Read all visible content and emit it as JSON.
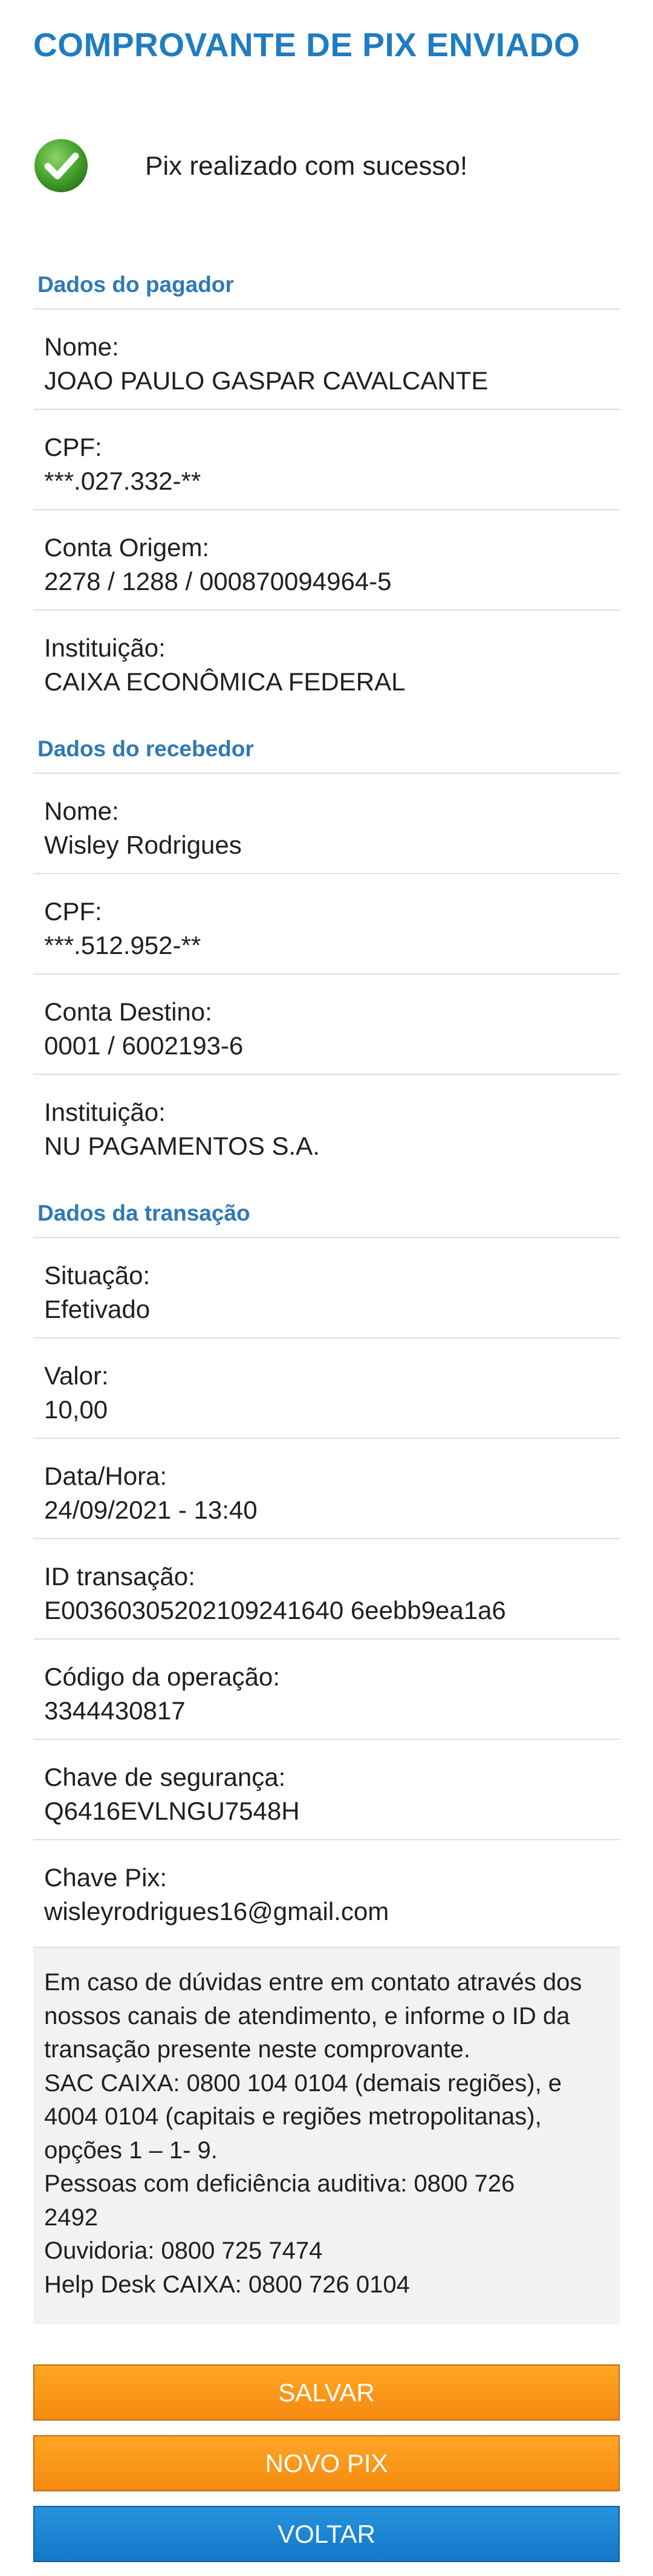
{
  "header": {
    "title": "COMPROVANTE DE PIX ENVIADO"
  },
  "status": {
    "icon": "check-circle-icon",
    "message": "Pix realizado com sucesso!",
    "color": "#3aa53a"
  },
  "pagador": {
    "section_title": "Dados do pagador",
    "fields": [
      {
        "label": "Nome:",
        "value": "JOAO PAULO GASPAR CAVALCANTE"
      },
      {
        "label": "CPF:",
        "value": "***.027.332-**"
      },
      {
        "label": "Conta Origem:",
        "value": "2278 / 1288 / 000870094964-5"
      },
      {
        "label": "Instituição:",
        "value": "CAIXA ECONÔMICA FEDERAL"
      }
    ]
  },
  "recebedor": {
    "section_title": "Dados do recebedor",
    "fields": [
      {
        "label": "Nome:",
        "value": "Wisley Rodrigues"
      },
      {
        "label": "CPF:",
        "value": "***.512.952-**"
      },
      {
        "label": "Conta Destino:",
        "value": "0001 / 6002193-6"
      },
      {
        "label": "Instituição:",
        "value": "NU PAGAMENTOS S.A."
      }
    ]
  },
  "transacao": {
    "section_title": "Dados da transação",
    "fields": [
      {
        "label": "Situação:",
        "value": "Efetivado"
      },
      {
        "label": "Valor:",
        "value": "10,00"
      },
      {
        "label": "Data/Hora:",
        "value": "24/09/2021 - 13:40"
      },
      {
        "label": "ID transação:",
        "value": "E00360305202109241640 6eebb9ea1a6"
      },
      {
        "label": "Código da operação:",
        "value": "3344430817"
      },
      {
        "label": "Chave de segurança:",
        "value": "Q6416EVLNGU7548H"
      },
      {
        "label": "Chave Pix:",
        "value": "wisleyrodrigues16@gmail.com"
      }
    ]
  },
  "notice": {
    "lines": [
      "Em caso de dúvidas entre em contato através dos",
      "nossos canais de atendimento, e informe o ID da",
      "transação presente neste comprovante.",
      "SAC CAIXA: 0800 104 0104 (demais regiões), e",
      "4004 0104 (capitais e regiões metropolitanas),",
      "opções 1 – 1- 9.",
      "Pessoas com deficiência auditiva: 0800 726",
      "2492",
      "Ouvidoria: 0800 725 7474",
      "Help Desk CAIXA: 0800 726 0104"
    ]
  },
  "actions": {
    "save_label": "SALVAR",
    "new_pix_label": "NOVO PIX",
    "back_label": "VOLTAR"
  },
  "colors": {
    "title": "#1f7cc0",
    "section": "#2f79b5",
    "button_orange": "#f68a12",
    "button_blue": "#1377c8"
  }
}
